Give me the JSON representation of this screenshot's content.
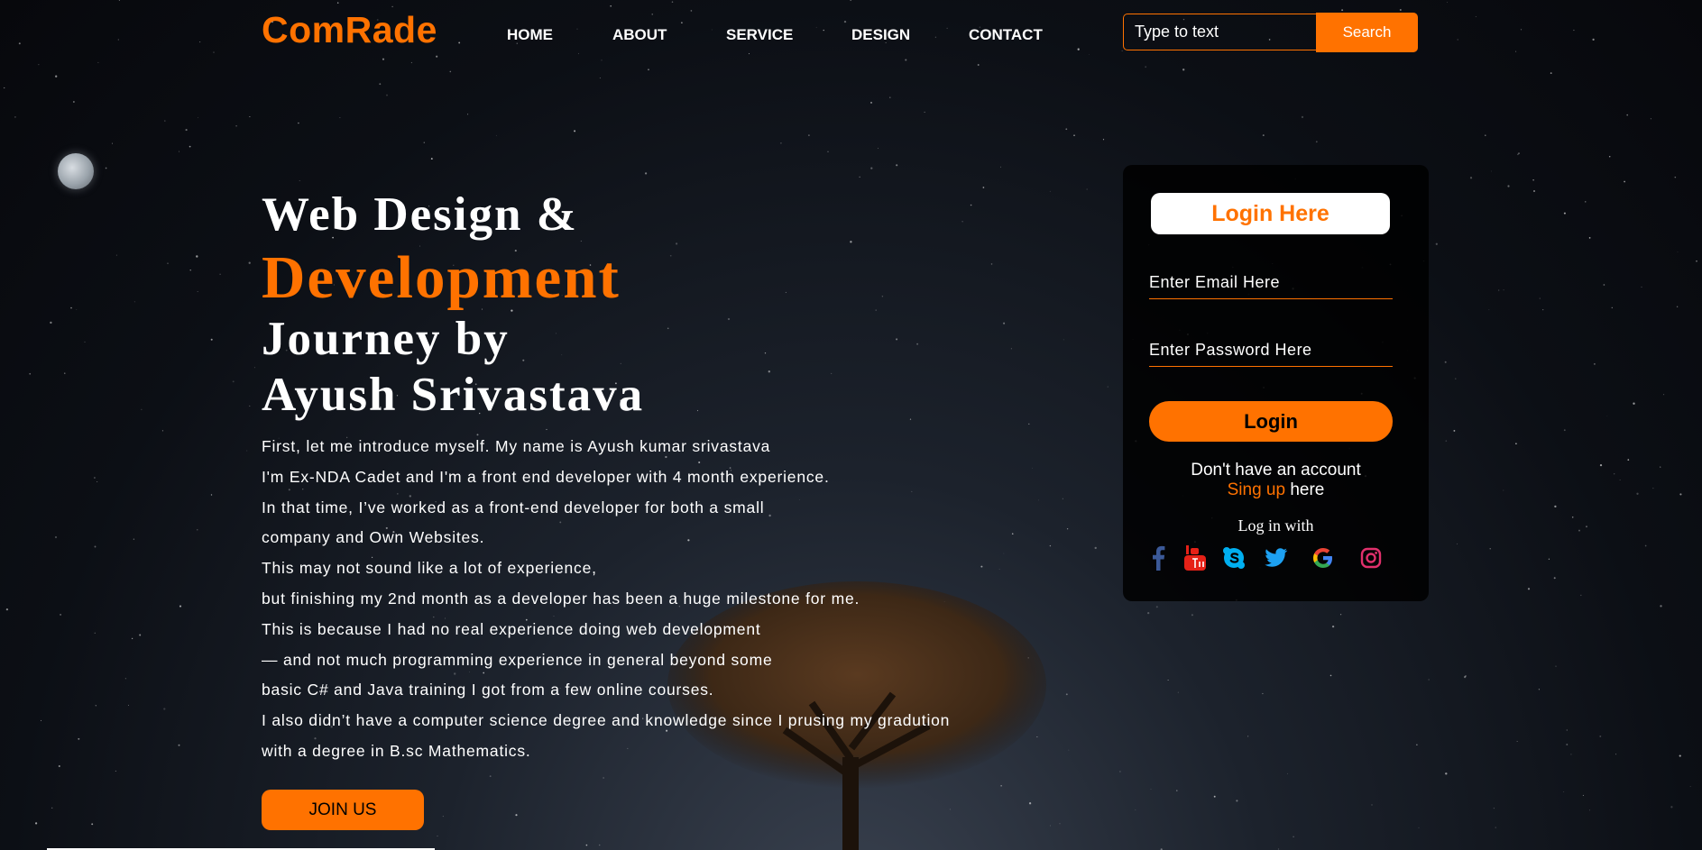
{
  "brand": {
    "name": "ComRade",
    "accent": "#ff7200"
  },
  "nav": {
    "items": [
      "HOME",
      "ABOUT",
      "SERVICE",
      "DESIGN",
      "CONTACT"
    ]
  },
  "search": {
    "placeholder": "Type to text",
    "button": "Search"
  },
  "hero": {
    "line1": "Web Design &",
    "line2": "Development",
    "line3": "Journey by",
    "line4": "Ayush Srivastava",
    "paragraph": [
      "First, let me introduce myself. My name is Ayush kumar srivastava",
      "I'm Ex-NDA Cadet and I'm a front end developer with 4 month experience.",
      "In that time, I’ve worked as a front-end developer for both a small",
      "company and Own Websites.",
      "This may not sound like a lot of experience,",
      "but finishing my 2nd month as a developer has been a huge milestone for me.",
      "This is because I had no real experience doing web development",
      "— and not much programming experience in general beyond some",
      "basic C# and Java training I got from a few online courses.",
      "I also didn’t have a computer science degree and knowledge since I prusing my gradution",
      "with a degree in B.sc Mathematics."
    ],
    "join_button": "JOIN US"
  },
  "login": {
    "title": "Login Here",
    "email_placeholder": "Enter Email Here",
    "password_placeholder": "Enter Password Here",
    "button": "Login",
    "no_account": "Don't have an account",
    "signup_link": "Sing up",
    "signup_suffix": " here",
    "login_with": "Log in with",
    "socials": [
      {
        "icon": "facebook-icon",
        "color": "#3b5998"
      },
      {
        "icon": "youtube-icon",
        "color": "#e62117"
      },
      {
        "icon": "skype-icon",
        "color": "#00aff0"
      },
      {
        "icon": "twitter-icon",
        "color": "#1da1f2"
      },
      {
        "icon": "google-icon",
        "color": "#4285f4"
      },
      {
        "icon": "instagram-icon",
        "color": "#e1306c"
      }
    ]
  }
}
